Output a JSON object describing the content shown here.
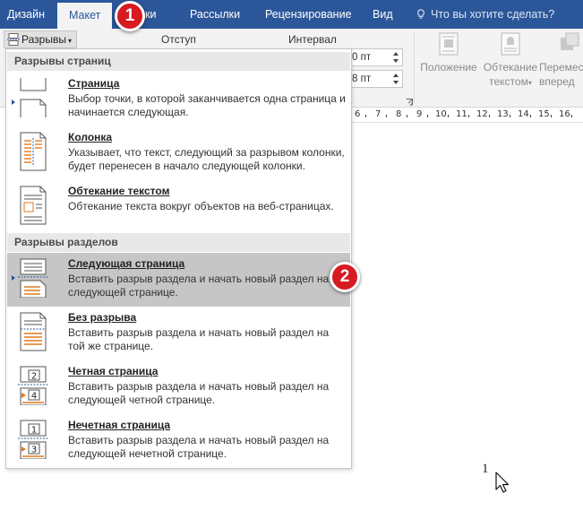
{
  "ribbon_tabs": [
    {
      "label": "Дизайн"
    },
    {
      "label": "Макет"
    },
    {
      "label": "ки"
    },
    {
      "label": "Рассылки"
    },
    {
      "label": "Рецензирование"
    },
    {
      "label": "Вид"
    }
  ],
  "tell_me": "Что вы хотите сделать?",
  "toolbar": {
    "breaks_label": "Разрывы",
    "indent_label": "Отступ",
    "spacing_label": "Интервал",
    "spin1_value": "0 пт",
    "spin2_value": "8 пт",
    "position_label": "Положение",
    "wrap_label": "Обтекание",
    "wrap_label2": "текстом",
    "move_label": "Перемест",
    "move_label2": "вперед"
  },
  "ruler_numbers": [
    "6",
    "7",
    "8",
    "9",
    "10",
    "11",
    "12",
    "13",
    "14",
    "15",
    "16"
  ],
  "menu": {
    "page_breaks_header": "Разрывы страниц",
    "section_breaks_header": "Разрывы разделов",
    "items": [
      {
        "title": "Страница",
        "desc": "Выбор точки, в которой заканчивается одна страница и начинается следующая."
      },
      {
        "title": "Колонка",
        "desc": "Указывает, что текст, следующий за разрывом колонки, будет перенесен в начало следующей колонки."
      },
      {
        "title": "Обтекание текстом",
        "desc": "Обтекание текста вокруг объектов на веб-страницах."
      },
      {
        "title": "Следующая страница",
        "desc": "Вставить разрыв раздела и начать новый раздел на следующей странице."
      },
      {
        "title": "Без разрыва",
        "desc": "Вставить разрыв раздела и начать новый раздел на той же странице."
      },
      {
        "title": "Четная страница",
        "desc": "Вставить разрыв раздела и начать новый раздел на следующей четной странице."
      },
      {
        "title": "Нечетная страница",
        "desc": "Вставить разрыв раздела и начать новый раздел на следующей нечетной странице."
      }
    ]
  },
  "icon_digits": {
    "even_top": "2",
    "even_bottom": "4",
    "odd_top": "1",
    "odd_bottom": "3"
  },
  "badges": {
    "step1": "1",
    "step2": "2"
  },
  "page_number": "1",
  "colors": {
    "ribbon_blue": "#2b579a",
    "badge_red": "#d71920",
    "highlight": "#c6c6c6",
    "icon_orange": "#e07a1f"
  }
}
